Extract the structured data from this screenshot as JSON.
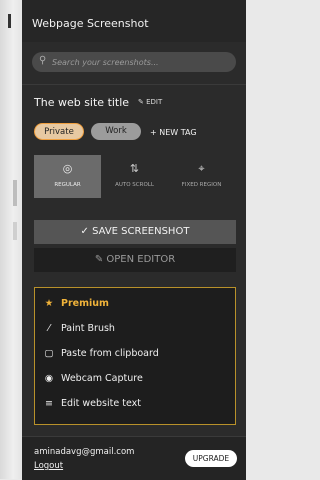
{
  "header": {
    "title": "Webpage Screenshot"
  },
  "search": {
    "placeholder": "Search your screenshots..."
  },
  "page": {
    "title": "The web site title",
    "edit_label": "EDIT"
  },
  "tags": {
    "items": [
      "Private",
      "Work"
    ],
    "new_tag_label": "+ NEW TAG"
  },
  "modes": [
    {
      "label": "REGULAR",
      "icon": "target-icon",
      "active": true
    },
    {
      "label": "AUTO SCROLL",
      "icon": "scroll-icon",
      "active": false
    },
    {
      "label": "FIXED REGION",
      "icon": "crop-icon",
      "active": false
    }
  ],
  "actions": {
    "save_label": "SAVE SCREENSHOT",
    "open_label": "OPEN EDITOR"
  },
  "premium": {
    "title": "Premium",
    "items": [
      "Paint Brush",
      "Paste from clipboard",
      "Webcam Capture",
      "Edit website text"
    ]
  },
  "account": {
    "email": "aminadavg@gmail.com",
    "logout_label": "Logout",
    "upgrade_label": "UPGRADE"
  },
  "colors": {
    "panel": "#2b2b2b",
    "gold": "#f0b33a",
    "private_tag": "#e7c9a2"
  }
}
